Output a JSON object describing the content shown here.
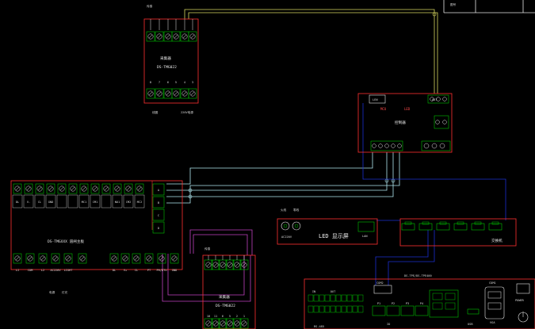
{
  "title_block": {
    "cell_1": "图号"
  },
  "detector_top": {
    "pin_labels_top": [
      "传感",
      "",
      "",
      "",
      "",
      ""
    ],
    "title_cn": "采集器",
    "model": "DS-TMG022",
    "bottom_pin_numbers": [
      "8",
      "7",
      "6",
      "5",
      "4",
      "3"
    ],
    "bottom_labels": [
      "线圈",
      "220V电源"
    ]
  },
  "controller": {
    "title": "控制器",
    "top_labels": [
      "LEN",
      "",
      "OUT"
    ],
    "red_labels": [
      "MCU",
      "LED"
    ]
  },
  "barrier": {
    "side_labels": [
      "A",
      "B",
      "C",
      "D"
    ],
    "top_terminals": [
      "DL",
      "V-",
      "CL",
      "GND",
      "",
      "",
      "MC1",
      "CM1",
      "",
      "NO1",
      "CM2",
      "MC2"
    ],
    "title": "DS-TMGXXX 道闸主板",
    "bottom_terminals": [
      "LI",
      "COM",
      "L2",
      "AC220V",
      "LIGHT",
      "",
      "DL",
      "V+",
      "CL",
      "PT",
      "PH/DTU",
      "GND"
    ],
    "bottom_notes": [
      "电源",
      "灯光"
    ]
  },
  "detector_bottom": {
    "title_cn": "采集器",
    "model": "DS-TMG022",
    "pin_labels_top": [
      "传感",
      "",
      "",
      ""
    ],
    "bottom_pin_numbers": [
      "10",
      "11",
      "6",
      "5",
      "2",
      "1"
    ]
  },
  "led_display": {
    "label_a": "火线",
    "label_b": "零线",
    "power": "AC220V",
    "title": "LED 显示屏",
    "port": "LAN"
  },
  "switch": {
    "title": "交换机"
  },
  "terminal": {
    "title": "DS-TPE/DS-TPE400",
    "ports": [
      "COM2",
      "P1",
      "P2",
      "P3",
      "P4",
      "COM1"
    ],
    "small_labels": [
      "IN",
      "OUT",
      "RS-485",
      "IO",
      "USB",
      "VGA",
      "POWER"
    ]
  },
  "colors": {
    "background": "#000000",
    "line_white": "#e6e6e6",
    "line_green": "#00c000",
    "line_red": "#ff3030",
    "wire_yellow": "#d8d860",
    "wire_blue": "#1a2fd0",
    "wire_cyan": "#b0e8f0",
    "wire_magenta": "#c040c0"
  }
}
